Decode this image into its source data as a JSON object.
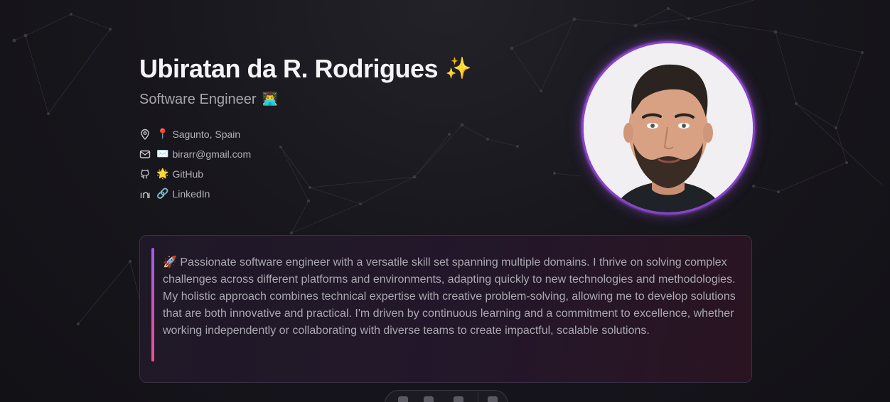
{
  "profile": {
    "name": "Ubiratan da R. Rodrigues",
    "name_emoji": "✨",
    "role": "Software Engineer",
    "role_emoji": "👨‍💻"
  },
  "contacts": [
    {
      "icon": "map-pin-icon",
      "emoji": "📍",
      "label": "Sagunto, Spain"
    },
    {
      "icon": "mail-icon",
      "emoji": "✉️",
      "label": "birarr@gmail.com"
    },
    {
      "icon": "github-icon",
      "emoji": "🌟",
      "label": "GitHub"
    },
    {
      "icon": "linkedin-icon",
      "emoji": "🔗",
      "label": "LinkedIn"
    }
  ],
  "bio": {
    "emoji": "🚀",
    "text": "Passionate software engineer with a versatile skill set spanning multiple domains. I thrive on solving complex challenges across different platforms and environments, adapting quickly to new technologies and methodologies. My holistic approach combines technical expertise with creative problem-solving, allowing me to develop solutions that are both innovative and practical. I'm driven by continuous learning and a commitment to excellence, whether working independently or collaborating with diverse teams to create impactful, scalable solutions."
  },
  "theme": {
    "background": "#141319",
    "accent_purple": "#8b3fd4",
    "accent_pink": "#ef4f93",
    "text_primary": "#f4f4f6",
    "text_secondary": "#b3b2b9"
  }
}
